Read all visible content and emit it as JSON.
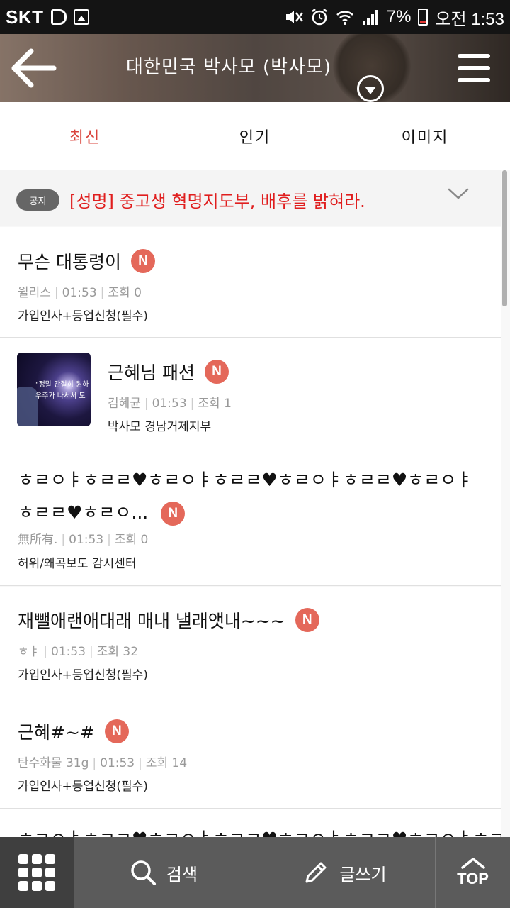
{
  "status_bar": {
    "carrier": "SKT",
    "carrier_icon": "D",
    "battery": "7%",
    "time": "오전 1:53",
    "icons": [
      "mute-icon",
      "alarm-icon",
      "wifi-icon",
      "signal-icon",
      "battery-icon"
    ]
  },
  "header": {
    "title": "대한민국 박사모 (박사모)"
  },
  "tabs": [
    {
      "label": "최신",
      "active": true
    },
    {
      "label": "인기",
      "active": false
    },
    {
      "label": "이미지",
      "active": false
    }
  ],
  "notice": {
    "badge": "공지",
    "text": "[성명] 중고생 혁명지도부, 배후를 밝혀라."
  },
  "posts": [
    {
      "title": "무슨 대통령이",
      "badge": "N",
      "author": "윌리스",
      "time": "01:53",
      "views": "조회 0",
      "board": "가입인사+등업신청(필수)"
    },
    {
      "title": "근혜님 패션",
      "badge": "N",
      "author": "김혜균",
      "time": "01:53",
      "views": "조회 1",
      "board": "박사모 경남거제지부",
      "thumb_text": "\"정말 간절히 원하\n우주가 나서서 도"
    },
    {
      "title": "ㅎㄹㅇㅑㅎㄹㄹ♥ㅎㄹㅇㅑㅎㄹㄹ♥ㅎㄹㅇㅑㅎㄹㄹ♥ㅎㄹㅇㅑㅎㄹㄹ♥ㅎㄹㅇ...",
      "badge": "N",
      "author": "無所有.",
      "time": "01:53",
      "views": "조회 0",
      "board": "허위/왜곡보도 감시센터"
    },
    {
      "title": "재뺄애랜애대래 매내 낼래앳내~~~",
      "badge": "N",
      "author": "ㅎㅑ",
      "time": "01:53",
      "views": "조회 32",
      "board": "가입인사+등업신청(필수)"
    },
    {
      "title": "근혜#~#",
      "badge": "N",
      "author": "탄수화물 31g",
      "time": "01:53",
      "views": "조회 14",
      "board": "가입인사+등업신청(필수)"
    },
    {
      "title": "ㅎㄹㅇㅑㅎㄹㄹ♥ㅎㄹㅇㅑㅎㄹㄹ♥ㅎㄹㅇㅑㅎㄹㄹ♥ㅎㄹㅇㅑㅎㄹ"
    }
  ],
  "bottom_bar": {
    "search_label": "검색",
    "write_label": "글쓰기",
    "top_label": "TOP"
  }
}
